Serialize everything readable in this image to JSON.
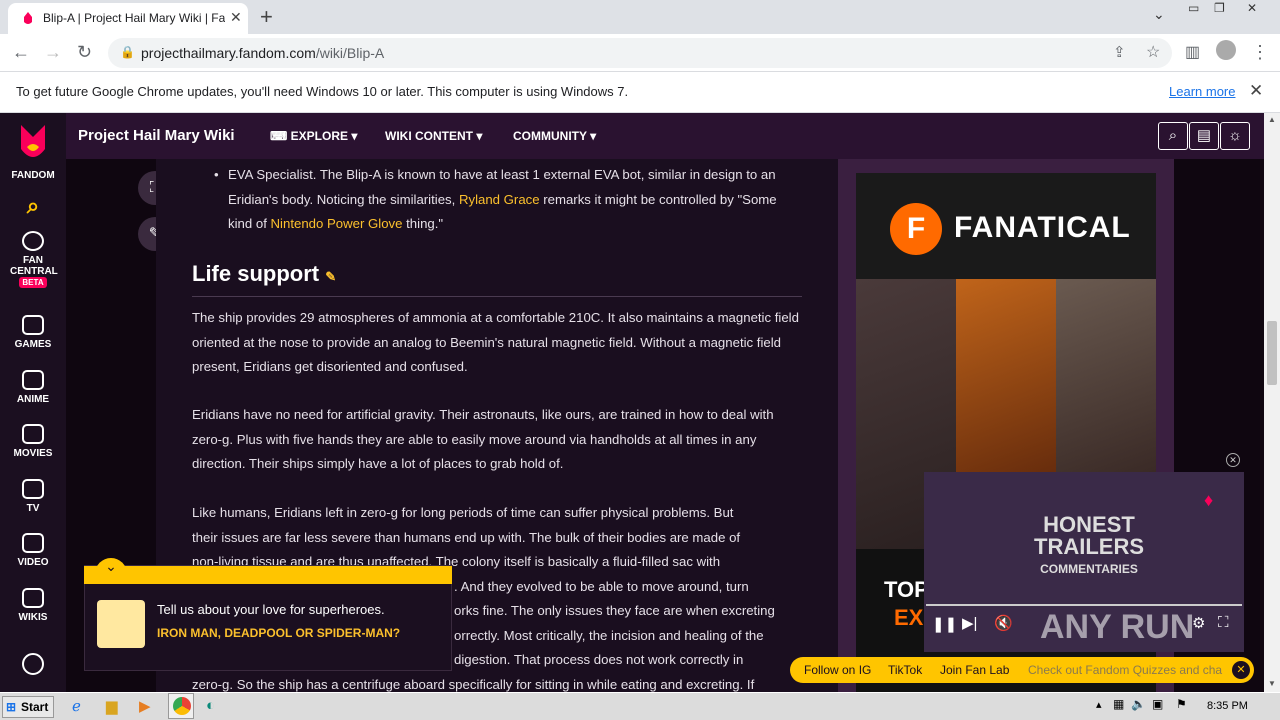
{
  "browser": {
    "tab_title": "Blip-A | Project Hail Mary Wiki | Fandom",
    "url_host": "projecthailmary.fandom.com",
    "url_path": "/wiki/Blip-A",
    "new_tab_label": "+",
    "info_message": "To get future Google Chrome updates, you'll need Windows 10 or later. This computer is using Windows 7.",
    "learn_more": "Learn more"
  },
  "rail": {
    "logo_label": "FANDOM",
    "items": [
      {
        "label": "FAN CENTRAL",
        "badge": "BETA",
        "icon": "rocket-icon"
      },
      {
        "label": "GAMES",
        "icon": "gamepad-icon"
      },
      {
        "label": "ANIME",
        "icon": "anime-face-icon"
      },
      {
        "label": "MOVIES",
        "icon": "film-icon"
      },
      {
        "label": "TV",
        "icon": "tv-icon"
      },
      {
        "label": "VIDEO",
        "icon": "play-icon"
      },
      {
        "label": "WIKIS",
        "icon": "book-icon"
      }
    ]
  },
  "wiki_header": {
    "name": "Project Hail Mary Wiki",
    "nav": [
      "EXPLORE",
      "WIKI CONTENT",
      "COMMUNITY"
    ]
  },
  "article": {
    "bullet_parts": [
      "EVA Specialist. The Blip-A is known to have at least 1 external EVA bot, similar in design to an Eridian's body. Noticing the similarities, ",
      "Ryland Grace",
      " remarks it might be controlled by \"Some kind of ",
      "Nintendo Power Glove",
      " thing.\""
    ],
    "heading": "Life support",
    "para1": "The ship provides 29 atmospheres of ammonia at a comfortable 210C. It also maintains a magnetic field oriented at the nose to provide an analog to Beemin's natural magnetic field. Without a magnetic field present, Eridians get disoriented and confused.",
    "para2": "Eridians have no need for artificial gravity. Their astronauts, like ours, are trained in how to deal with zero-g. Plus with five hands they are able to easily move around via handholds at all times in any direction. Their ships simply have a lot of places to grab hold of.",
    "para3_lines": [
      "Like humans, Eridians left in zero-g for long periods of time can suffer physical problems. But",
      "their issues are far less severe than humans end up with. The bulk of their bodies are made of",
      "non-living tissue and are thus unaffected. The colony itself is basically a fluid-filled sac with",
      ". And they evolved to be able to move around, turn",
      "orks fine. The only issues they face are when excreting",
      "orrectly. Most critically, the incision and healing of the",
      "digestion. That process does not work correctly in",
      "zero-g. So the ship has a centrifuge aboard specifically for sitting in while eating and excreting. If"
    ]
  },
  "ad": {
    "brand": "FANATICAL",
    "partial_headline_1": "TOP",
    "partial_headline_2": "EXC"
  },
  "promo": {
    "question": "Tell us about your love for superheroes.",
    "answer": "IRON MAN, DEADPOOL OR SPIDER-MAN?"
  },
  "video": {
    "title_line1": "HONEST",
    "title_line2": "TRAILERS",
    "title_line3": "COMMENTARIES",
    "watermark": "ANY RUN"
  },
  "social_bar": [
    "Follow on IG",
    "TikTok",
    "Join Fan Lab",
    "Check out Fandom Quizzes and cha"
  ],
  "taskbar": {
    "start": "Start",
    "clock": "8:35 PM"
  },
  "colors": {
    "fandom_pink": "#fa005a",
    "link_yellow": "#fbc02d",
    "header_purple": "#2a1230"
  }
}
